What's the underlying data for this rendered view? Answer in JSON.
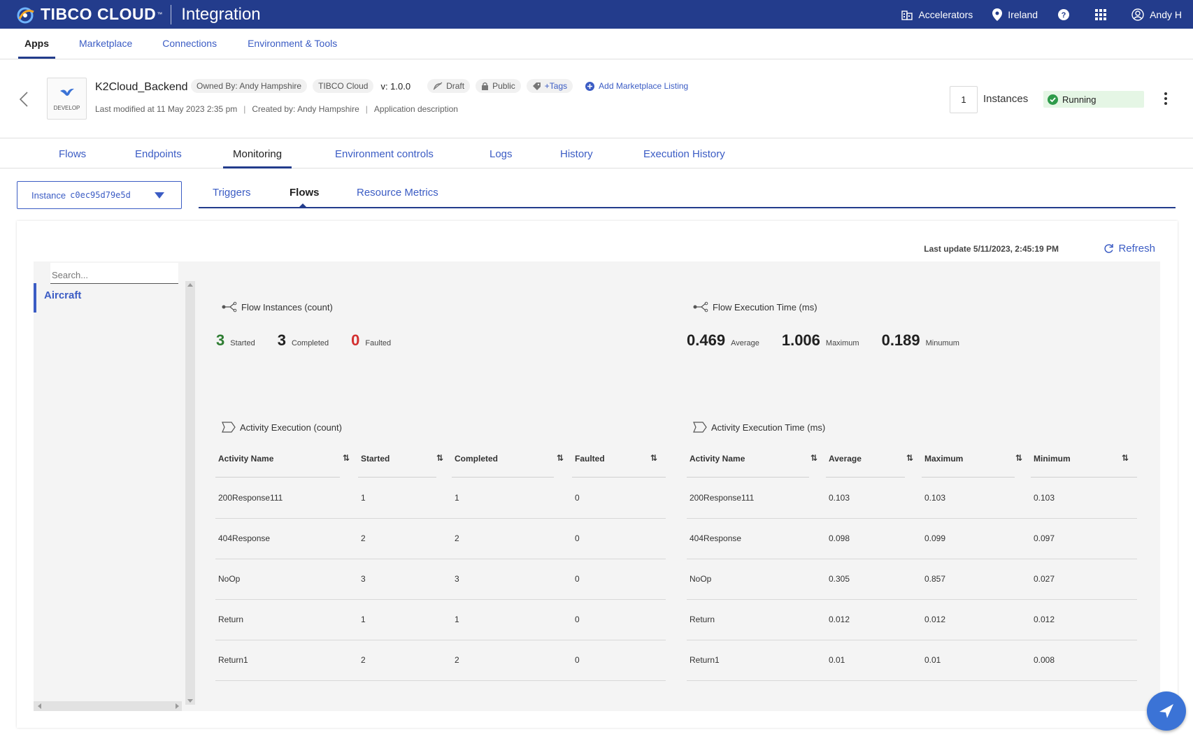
{
  "topbar": {
    "brand": "TIBCO CLOUD",
    "brand_tm": "™",
    "product": "Integration",
    "accelerators": "Accelerators",
    "region": "Ireland",
    "user": "Andy H"
  },
  "nav": {
    "items": [
      "Apps",
      "Marketplace",
      "Connections",
      "Environment & Tools"
    ],
    "active": "Apps"
  },
  "app": {
    "icon_label": "DEVELOP",
    "name": "K2Cloud_Backend",
    "owned_by": "Owned By:  Andy Hampshire",
    "org": "TIBCO Cloud",
    "version": "v: 1.0.0",
    "draft": "Draft",
    "visibility": "Public",
    "tags": "+Tags",
    "add_listing": "Add Marketplace Listing",
    "last_modified": "Last modified at 11 May 2023 2:35 pm",
    "created_by": "Created by: Andy Hampshire",
    "description": "Application description",
    "instances_count": "1",
    "instances_label": "Instances",
    "status": "Running",
    "status_color": "#2e9b4a"
  },
  "apptabs": [
    "Flows",
    "Endpoints",
    "Monitoring",
    "Environment controls",
    "Logs",
    "History",
    "Execution History"
  ],
  "instance_select": {
    "label": "Instance",
    "id": "c0ec95d79e5d"
  },
  "subtabs": [
    "Triggers",
    "Flows",
    "Resource Metrics"
  ],
  "panel": {
    "last_update": "Last update 5/11/2023, 2:45:19 PM",
    "refresh": "Refresh",
    "search_placeholder": "Search...",
    "flows": [
      "Aircraft"
    ]
  },
  "flow_instances": {
    "title": "Flow Instances (count)",
    "started": "3",
    "started_label": "Started",
    "completed": "3",
    "completed_label": "Completed",
    "faulted": "0",
    "faulted_label": "Faulted"
  },
  "flow_exec_time": {
    "title": "Flow Execution Time (ms)",
    "average": "0.469",
    "average_label": "Average",
    "maximum": "1.006",
    "maximum_label": "Maximum",
    "minimum": "0.189",
    "minimum_label": "Minumum"
  },
  "activity_count": {
    "title": "Activity Execution (count)",
    "headers": [
      "Activity Name",
      "Started",
      "Completed",
      "Faulted"
    ],
    "rows": [
      [
        "200Response111",
        "1",
        "1",
        "0"
      ],
      [
        "404Response",
        "2",
        "2",
        "0"
      ],
      [
        "NoOp",
        "3",
        "3",
        "0"
      ],
      [
        "Return",
        "1",
        "1",
        "0"
      ],
      [
        "Return1",
        "2",
        "2",
        "0"
      ]
    ]
  },
  "activity_time": {
    "title": "Activity Execution Time (ms)",
    "headers": [
      "Activity Name",
      "Average",
      "Maximum",
      "Minimum"
    ],
    "rows": [
      [
        "200Response111",
        "0.103",
        "0.103",
        "0.103"
      ],
      [
        "404Response",
        "0.098",
        "0.099",
        "0.097"
      ],
      [
        "NoOp",
        "0.305",
        "0.857",
        "0.027"
      ],
      [
        "Return",
        "0.012",
        "0.012",
        "0.012"
      ],
      [
        "Return1",
        "0.01",
        "0.01",
        "0.008"
      ]
    ]
  },
  "colors": {
    "topbar": "#233c8c",
    "accent": "#3b5cc4",
    "started": "#2e7d32",
    "faulted": "#d32f2f"
  }
}
